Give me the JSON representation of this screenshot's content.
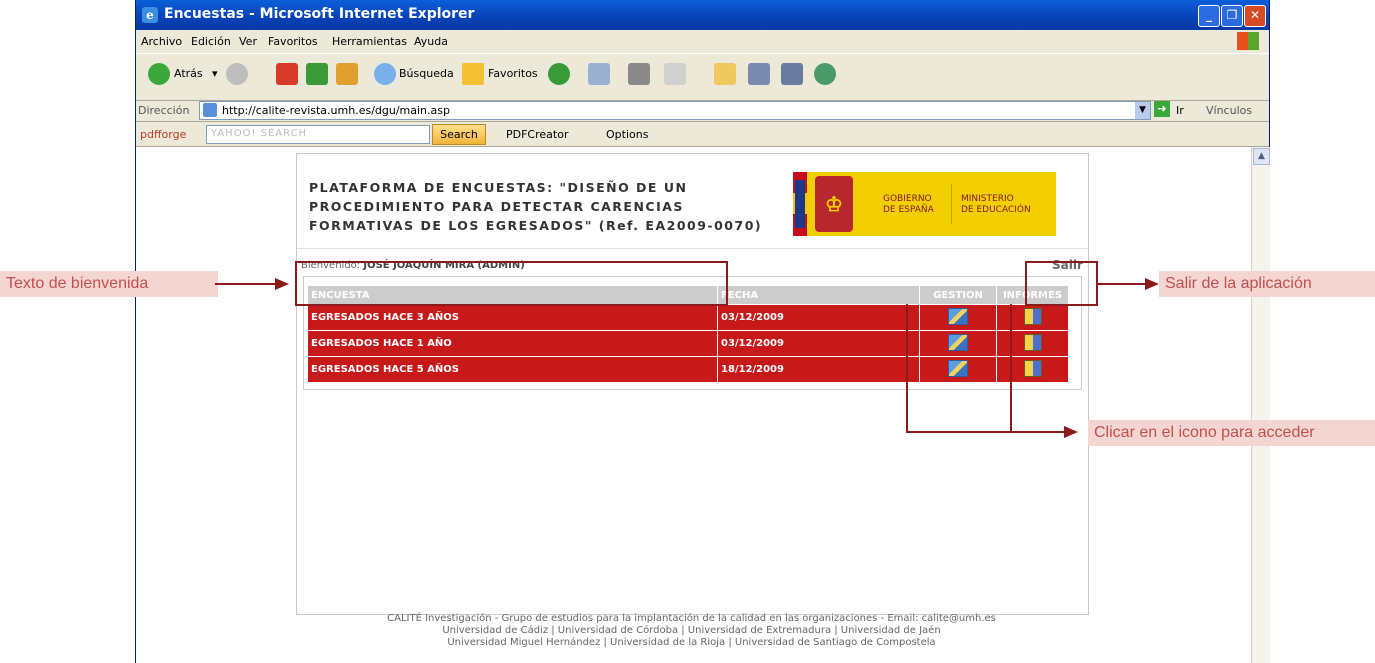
{
  "window": {
    "title": "Encuestas - Microsoft Internet Explorer"
  },
  "menu": [
    "Archivo",
    "Edición",
    "Ver",
    "Favoritos",
    "Herramientas",
    "Ayuda"
  ],
  "toolbar": {
    "back": "Atrás",
    "search": "Búsqueda",
    "favorites": "Favoritos"
  },
  "address": {
    "label": "Dirección",
    "url": "http://calite-revista.umh.es/dgu/main.asp",
    "go": "Ir",
    "links": "Vínculos"
  },
  "pdfbar": {
    "brand": "pdfforge",
    "search_placeholder": "YAHOO! SEARCH",
    "search_button": "Search",
    "creator": "PDFCreator",
    "options": "Options"
  },
  "header": {
    "title_lines": [
      "PLATAFORMA DE ENCUESTAS: \"DISEÑO DE UN",
      "PROCEDIMIENTO PARA DETECTAR CARENCIAS",
      "FORMATIVAS DE LOS EGRESADOS\" (Ref. EA2009-0070)"
    ],
    "gov_line1": "GOBIERNO",
    "gov_line2": "DE ESPAÑA",
    "min_line1": "MINISTERIO",
    "min_line2": "DE EDUCACIÓN"
  },
  "welcome": {
    "label": "Bienvenido:",
    "user": "JOSÉ JOAQUÍN MIRA (ADMIN)"
  },
  "logout": "Salir",
  "table": {
    "headers": [
      "ENCUESTA",
      "FECHA",
      "GESTION",
      "INFORMES"
    ],
    "rows": [
      {
        "encuesta": "EGRESADOS HACE 3 AÑOS",
        "fecha": "03/12/2009"
      },
      {
        "encuesta": "EGRESADOS HACE 1 AÑO",
        "fecha": "03/12/2009"
      },
      {
        "encuesta": "EGRESADOS HACE 5 AÑOS",
        "fecha": "18/12/2009"
      }
    ]
  },
  "footer": [
    "CALITÉ Investigación - Grupo de estudios para la implantación de la calidad en las organizaciones - Email: calite@umh.es",
    "Universidad de Cádiz | Universidad de Córdoba | Universidad de Extremadura | Universidad de Jaén",
    "Universidad Miguel Hernández | Universidad de la Rioja | Universidad de Santiago de Compostela"
  ],
  "annotations": {
    "welcome": "Texto de bienvenida",
    "logout": "Salir de la aplicación",
    "icons": "Clicar en el icono para acceder"
  }
}
